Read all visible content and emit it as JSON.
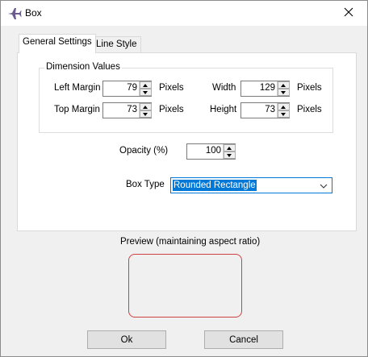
{
  "window": {
    "title": "Box"
  },
  "tabs": [
    {
      "label": "General Settings",
      "active": true
    },
    {
      "label": "Line Style",
      "active": false
    }
  ],
  "dimension_group": {
    "legend": "Dimension Values",
    "left_margin": {
      "label": "Left Margin",
      "value": "79",
      "unit": "Pixels"
    },
    "top_margin": {
      "label": "Top Margin",
      "value": "73",
      "unit": "Pixels"
    },
    "width": {
      "label": "Width",
      "value": "129",
      "unit": "Pixels"
    },
    "height": {
      "label": "Height",
      "value": "73",
      "unit": "Pixels"
    }
  },
  "opacity": {
    "label": "Opacity (%)",
    "value": "100"
  },
  "box_type": {
    "label": "Box Type",
    "selected": "Rounded Rectangle"
  },
  "preview": {
    "label": "Preview (maintaining aspect ratio)",
    "border_color": "#d04040"
  },
  "buttons": {
    "ok": "Ok",
    "cancel": "Cancel"
  },
  "colors": {
    "accent": "#0078d7"
  },
  "icons": {
    "app": "airplane-icon",
    "close": "close-icon"
  }
}
